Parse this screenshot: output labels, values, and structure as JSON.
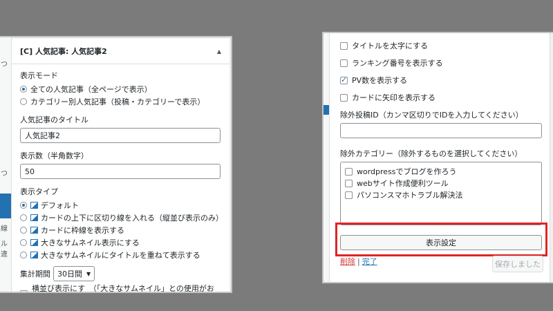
{
  "left": {
    "title": "[C] 人気記事: 人気記事2",
    "display_mode_label": "表示モード",
    "modes": [
      "全ての人気記事（全ページで表示）",
      "カテゴリー別人気記事（投稿・カテゴリーで表示）"
    ],
    "title_label": "人気記事のタイトル",
    "title_value": "人気記事2",
    "count_label": "表示数（半角数字）",
    "count_value": "50",
    "type_label": "表示タイプ",
    "types": [
      "デフォルト",
      "カードの上下に区切り線を入れる（縦並び表示のみ）",
      "カードに枠線を表示する",
      "大きなサムネイル表示にする",
      "大きなサムネイルにタイトルを重ねて表示する"
    ],
    "period_label": "集計期間",
    "period_value": "30日間",
    "horizontal_label": "横並び表示にする",
    "horizontal_note": "（「大きなサムネイル」との使用がお勧め）",
    "strip_fragments": [
      "つ",
      "つ",
      "線",
      "ル違"
    ]
  },
  "right": {
    "options": [
      {
        "label": "タイトルを太字にする",
        "checked": false
      },
      {
        "label": "ランキング番号を表示する",
        "checked": false
      },
      {
        "label": "PV数を表示する",
        "checked": true
      },
      {
        "label": "カードに矢印を表示する",
        "checked": false
      }
    ],
    "exclude_posts_label": "除外投稿ID（カンマ区切りでIDを入力してください）",
    "exclude_cats_label": "除外カテゴリー（除外するものを選択してください）",
    "categories": [
      "wordpressでブログを作ろう",
      "webサイト作成便利ツール",
      "パソコンスマホトラブル解決法"
    ],
    "settings_button": "表示設定",
    "delete_link": "削除",
    "done_link": "完了",
    "separator": "|",
    "save_button": "保存しました"
  }
}
